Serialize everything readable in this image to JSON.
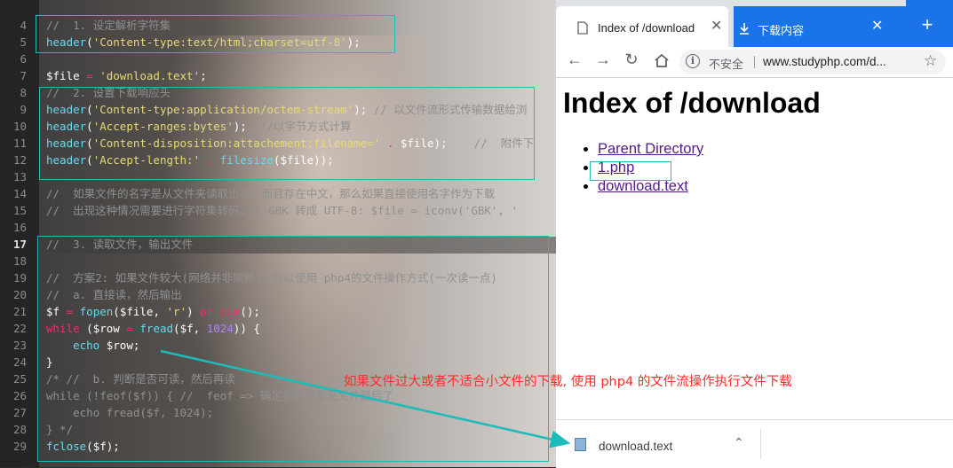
{
  "editor": {
    "line_numbers": [
      "4",
      "5",
      "6",
      "7",
      "8",
      "9",
      "10",
      "11",
      "12",
      "13",
      "14",
      "15",
      "16",
      "17",
      "18",
      "19",
      "20",
      "21",
      "22",
      "23",
      "24",
      "25",
      "26",
      "27",
      "28",
      "29"
    ],
    "current_line": "17",
    "lines": [
      [
        {
          "t": "//  1. 设定解析字符集",
          "c": "cm"
        }
      ],
      [
        {
          "t": "header",
          "c": "fn"
        },
        {
          "t": "(",
          "c": "pl"
        },
        {
          "t": "'Content-type:text/html;charset=utf-8'",
          "c": "str"
        },
        {
          "t": ");",
          "c": "pl"
        }
      ],
      [],
      [
        {
          "t": "$file",
          "c": "var"
        },
        {
          "t": " = ",
          "c": "op"
        },
        {
          "t": "'download.text'",
          "c": "str"
        },
        {
          "t": ";",
          "c": "pl"
        }
      ],
      [
        {
          "t": "//  2. 设置下载响应头",
          "c": "cm"
        }
      ],
      [
        {
          "t": "header",
          "c": "fn"
        },
        {
          "t": "(",
          "c": "pl"
        },
        {
          "t": "'Content-type:application/octem-stream'",
          "c": "str"
        },
        {
          "t": "); ",
          "c": "pl"
        },
        {
          "t": "// 以文件流形式传输数据给浏",
          "c": "cm"
        }
      ],
      [
        {
          "t": "header",
          "c": "fn"
        },
        {
          "t": "(",
          "c": "pl"
        },
        {
          "t": "'Accept-ranges:bytes'",
          "c": "str"
        },
        {
          "t": ");  ",
          "c": "pl"
        },
        {
          "t": "//以字节方式计算",
          "c": "cm"
        }
      ],
      [
        {
          "t": "header",
          "c": "fn"
        },
        {
          "t": "(",
          "c": "pl"
        },
        {
          "t": "'Content-disposition:attachement;filename='",
          "c": "str"
        },
        {
          "t": " . ",
          "c": "op"
        },
        {
          "t": "$file",
          "c": "var"
        },
        {
          "t": ");    ",
          "c": "pl"
        },
        {
          "t": "//  附件下",
          "c": "cm"
        }
      ],
      [
        {
          "t": "header",
          "c": "fn"
        },
        {
          "t": "(",
          "c": "pl"
        },
        {
          "t": "'Accept-length:'",
          "c": "str"
        },
        {
          "t": " . ",
          "c": "op"
        },
        {
          "t": "filesize",
          "c": "fn"
        },
        {
          "t": "(",
          "c": "pl"
        },
        {
          "t": "$file",
          "c": "var"
        },
        {
          "t": "));",
          "c": "pl"
        }
      ],
      [],
      [
        {
          "t": "//  如果文件的名字是从文件夹读取出来，而且存在中文，那么如果直接使用名字作为下载",
          "c": "cm"
        }
      ],
      [
        {
          "t": "//  出现这种情况需要进行字符集转码，从 GBK 转成 UTF-8: $file = iconv('GBK', '",
          "c": "cm"
        }
      ],
      [],
      [
        {
          "t": "//  3. 读取文件，输出文件",
          "c": "cm"
        }
      ],
      [],
      [
        {
          "t": "//  方案2: 如果文件较大(网络并非顺畅)，可以使用 php4的文件操作方式(一次读一点)",
          "c": "cm"
        }
      ],
      [
        {
          "t": "//  a. 直接读，然后输出",
          "c": "cm"
        }
      ],
      [
        {
          "t": "$f",
          "c": "var"
        },
        {
          "t": " = ",
          "c": "op"
        },
        {
          "t": "fopen",
          "c": "fn"
        },
        {
          "t": "(",
          "c": "pl"
        },
        {
          "t": "$file",
          "c": "var"
        },
        {
          "t": ", ",
          "c": "pl"
        },
        {
          "t": "'r'",
          "c": "str"
        },
        {
          "t": ") ",
          "c": "pl"
        },
        {
          "t": "or",
          "c": "kw"
        },
        {
          "t": " ",
          "c": "pl"
        },
        {
          "t": "die",
          "c": "kw"
        },
        {
          "t": "();",
          "c": "pl"
        }
      ],
      [
        {
          "t": "while",
          "c": "kw"
        },
        {
          "t": " (",
          "c": "pl"
        },
        {
          "t": "$row",
          "c": "var"
        },
        {
          "t": " = ",
          "c": "op"
        },
        {
          "t": "fread",
          "c": "fn"
        },
        {
          "t": "(",
          "c": "pl"
        },
        {
          "t": "$f",
          "c": "var"
        },
        {
          "t": ", ",
          "c": "pl"
        },
        {
          "t": "1024",
          "c": "num"
        },
        {
          "t": ")) {",
          "c": "pl"
        }
      ],
      [
        {
          "t": "    ",
          "c": "pl"
        },
        {
          "t": "echo",
          "c": "fn"
        },
        {
          "t": " ",
          "c": "pl"
        },
        {
          "t": "$row",
          "c": "var"
        },
        {
          "t": ";",
          "c": "pl"
        }
      ],
      [
        {
          "t": "}",
          "c": "pl"
        }
      ],
      [
        {
          "t": "/* //  b. 判断是否可读，然后再读",
          "c": "cm"
        }
      ],
      [
        {
          "t": "while (!feof($f)) { //  feof => 确定指针是都是文件最后了",
          "c": "cm"
        }
      ],
      [
        {
          "t": "    echo fread($f, 1024);",
          "c": "cm"
        }
      ],
      [
        {
          "t": "} */",
          "c": "cm"
        }
      ],
      [
        {
          "t": "fclose",
          "c": "fn"
        },
        {
          "t": "(",
          "c": "pl"
        },
        {
          "t": "$f",
          "c": "var"
        },
        {
          "t": ");",
          "c": "pl"
        }
      ]
    ]
  },
  "browser": {
    "tabs": [
      {
        "label": "Index of /download",
        "active": true
      },
      {
        "label": "下载内容",
        "active": false
      }
    ],
    "accent_color": "#1a73e8",
    "security_label": "不安全",
    "url": "www.studyphp.com/d...",
    "page": {
      "heading": "Index of /download",
      "links": [
        "Parent Directory",
        "1.php",
        "download.text"
      ]
    },
    "download_bar": {
      "file_name": "download.text"
    }
  },
  "annotation": {
    "text": "如果文件过大或者不适合小文件的下载, 使用 php4 的文件流操作执行文件下载",
    "color": "#ff2b2b"
  },
  "highlight_color": "#1bbcb9"
}
